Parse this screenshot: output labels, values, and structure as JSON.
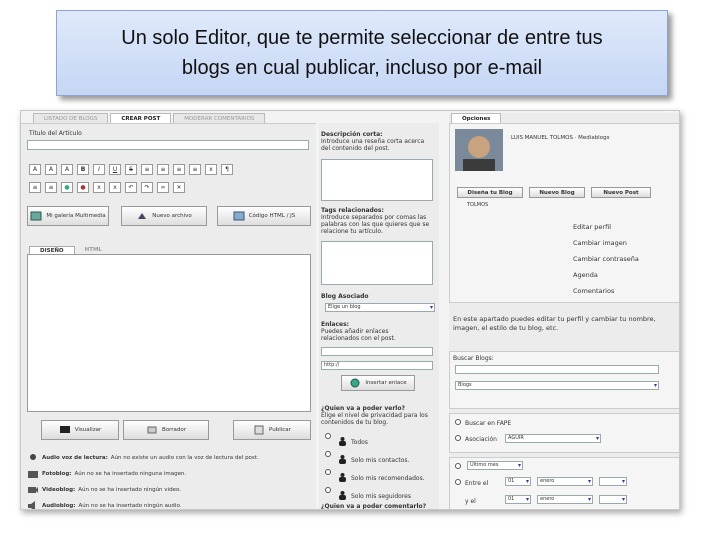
{
  "banner": {
    "line1": "Un solo Editor, que te permite seleccionar de entre tus",
    "line2": "blogs en cual publicar, incluso por e-mail"
  },
  "tabs": [
    "LISTADO DE BLOGS",
    "CREAR POST",
    "MODERAR COMENTARIOS"
  ],
  "editor": {
    "title_label": "Título del Artículo",
    "toolbar_row1": [
      "A",
      "A",
      "A",
      "B",
      "I",
      "U",
      "S",
      "≡",
      "≡",
      "≡",
      "≡",
      "x",
      "¶"
    ],
    "toolbar_row2": [
      "≡",
      "≡",
      "●",
      "●",
      "x",
      "x",
      "↶",
      "↷",
      "∞",
      "✕"
    ],
    "buttons": [
      "Mi galería Multimedia",
      "Nuevo archivo",
      "Código HTML / JS"
    ],
    "subtabs": [
      "DISEÑO",
      "HTML"
    ],
    "actions": [
      "Visualizar",
      "Borrador",
      "Publicar"
    ],
    "media": [
      {
        "label": "Audio voz de lectura:",
        "text": "Aún no existe un audio con la voz de lectura del post."
      },
      {
        "label": "Fotoblog:",
        "text": "Aún no se ha insertado ninguna imagen."
      },
      {
        "label": "Videoblog:",
        "text": "Aún no se ha insertado ningún video."
      },
      {
        "label": "Audioblog:",
        "text": "Aún no se ha insertado ningún audio."
      }
    ]
  },
  "middle": {
    "desc_label": "Descripción corta:",
    "desc_help": "Introduce una reseña corta acerca del contenido del post.",
    "tags_label": "Tags relacionados:",
    "tags_help": "Introduce separados por comas las palabras con las que quieres que se relacione tu artículo.",
    "blog_label": "Blog Asociado",
    "blog_select": "Elige un blog",
    "links_label": "Enlaces:",
    "links_help": "Puedes añadir enlaces relacionados con el post.",
    "link_value": "http://",
    "insert_link": "Insertar enlace",
    "visibility_q": "¿Quien va a poder verlo?",
    "visibility_help": "Elige el nivel de privacidad para los contenidos de tu blog.",
    "visibility_options": [
      "Todos",
      "Solo mis contactos.",
      "Solo mis recomendados.",
      "Solo mis seguidores"
    ],
    "comment_q": "¿Quien va a poder comentarlo?"
  },
  "right": {
    "tab": "Opciones",
    "user": "LUIS MANUEL TOLMOS · Mediablogs",
    "buttons": [
      "Diseña tu Blog",
      "Nuevo Blog",
      "Nuevo Post"
    ],
    "tag": "TOLMOS",
    "menu": [
      "Editar perfil",
      "Cambiar imagen",
      "Cambiar contraseña",
      "Agenda",
      "Comentarios"
    ],
    "info": "En este apartado puedes editar tu perfil y cambiar tu nombre, imagen, el estilo de tu blog, etc.",
    "search_label": "Buscar Blogs:",
    "search_select": "Blogs",
    "radio1": "Buscar en FAPE",
    "radio2": "Asociación",
    "radio2_select": "AGUIR",
    "period": "Último mes",
    "between": "Entre el",
    "and": "y el",
    "day": "01",
    "month": "enero"
  }
}
